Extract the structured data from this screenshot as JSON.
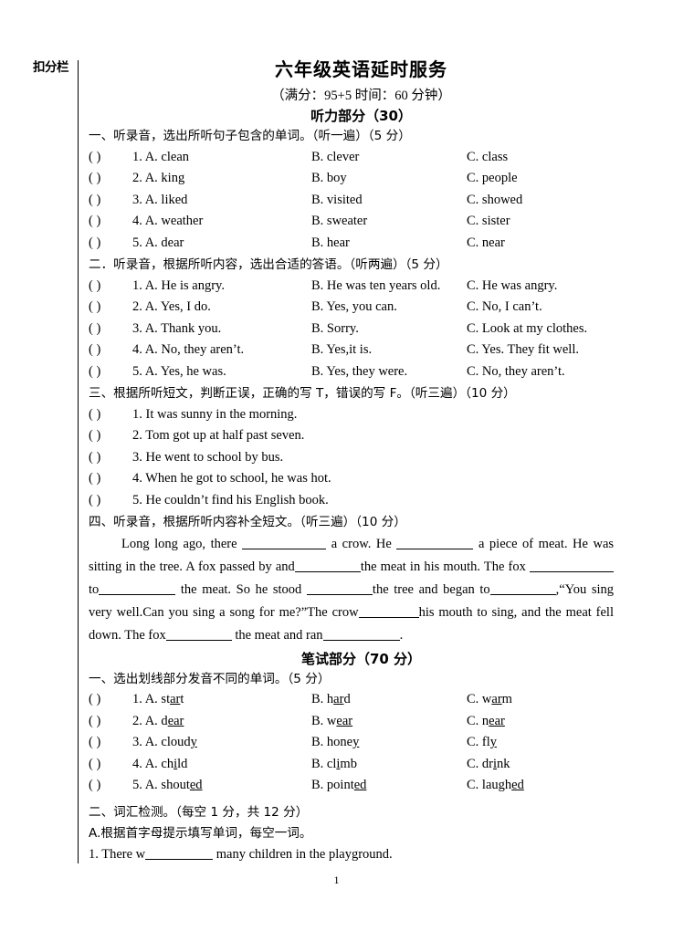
{
  "deduction_column": {
    "label": "扣分栏"
  },
  "header": {
    "title": "六年级英语延时服务",
    "subtitle": "（满分：95+5    时间：60 分钟）"
  },
  "parts": [
    {
      "heading": "听力部分（30）",
      "sections": [
        {
          "heading": "一、听录音，选出所听句子包含的单词。（听一遍）（5 分）",
          "type": "mcq",
          "items": [
            {
              "paren": "(        )",
              "num": "1.",
              "a": "A. clean",
              "b": "B. clever",
              "c": "C. class"
            },
            {
              "paren": "(        )",
              "num": "2.",
              "a": "A. king",
              "b": "B. boy",
              "c": "C. people"
            },
            {
              "paren": "(        )",
              "num": "3.",
              "a": "A. liked",
              "b": "B. visited",
              "c": "C. showed"
            },
            {
              "paren": "(        )",
              "num": "4.",
              "a": "A. weather",
              "b": "B. sweater",
              "c": "C. sister"
            },
            {
              "paren": "(        )",
              "num": "5.",
              "a": "A. dear",
              "b": "B. hear",
              "c": "C. near"
            }
          ]
        },
        {
          "heading": "二．听录音，根据所听内容，选出合适的答语。（听两遍）（5 分）",
          "type": "mcq",
          "items": [
            {
              "paren": "(        )",
              "num": "1.",
              "a": "A. He is angry.",
              "b": "B. He was ten years old.",
              "c": "C. He was angry."
            },
            {
              "paren": "(        )",
              "num": "2.",
              "a": "A. Yes, I do.",
              "b": "B. Yes, you can.",
              "c": "C. No, I can’t."
            },
            {
              "paren": "(        )",
              "num": "3.",
              "a": "A. Thank you.",
              "b": "B. Sorry.",
              "c": "C. Look at my clothes."
            },
            {
              "paren": "(        )",
              "num": "4.",
              "a": "A. No, they aren’t.",
              "b": "B. Yes,it is.",
              "c": "C. Yes. They fit well."
            },
            {
              "paren": "(        )",
              "num": "5.",
              "a": "A. Yes, he was.",
              "b": "B. Yes, they were.",
              "c": "C. No, they aren’t."
            }
          ]
        },
        {
          "heading": "三、根据所听短文，判断正误，正确的写 T，错误的写 F。（听三遍）（10 分）",
          "type": "truefalse",
          "items": [
            {
              "paren": "(        )",
              "num": "1.",
              "text": "It was sunny in the morning."
            },
            {
              "paren": "(        )",
              "num": "2.",
              "text": "Tom got up at half past seven."
            },
            {
              "paren": "(        )",
              "num": "3.",
              "text": "He went to school by bus."
            },
            {
              "paren": "(        )",
              "num": "4.",
              "text": "When he got to school, he was hot."
            },
            {
              "paren": "(        )",
              "num": "5.",
              "text": "He couldn’t find his English book."
            }
          ]
        },
        {
          "heading": "四、听录音，根据所听内容补全短文。（听三遍）（10 分）",
          "type": "cloze",
          "passage": {
            "t1": "Long long ago, there",
            "t2": "a crow. He",
            "t3": "a piece of meat. He was sitting in the tree. A fox passed by and",
            "t4": "the meat in his mouth. The fox",
            "t5": "to",
            "t6": "the meat. So he stood",
            "t7": "the tree and began to",
            "t8": ",“You sing very well.Can you sing a song for me?”The crow",
            "t9": "his mouth to sing, and the meat fell down. The fox",
            "t10": "the meat and ran",
            "t11": "."
          }
        }
      ]
    },
    {
      "heading": "笔试部分（70 分）",
      "sections": [
        {
          "heading": "一、选出划线部分发音不同的单词。（5 分）",
          "type": "mcq-underline",
          "items": [
            {
              "paren": "(        )",
              "num": "1.",
              "a": [
                "A. st",
                "ar",
                "t"
              ],
              "b": [
                "B. h",
                "ar",
                "d"
              ],
              "c": [
                "C. w",
                "ar",
                "m"
              ]
            },
            {
              "paren": "(        )",
              "num": "2.",
              "a": [
                "A. d",
                "ear",
                ""
              ],
              "b": [
                "B. w",
                "ear",
                ""
              ],
              "c": [
                "C. n",
                "ear",
                ""
              ]
            },
            {
              "paren": "(        )",
              "num": "3.",
              "a": [
                "A. cloud",
                "y",
                ""
              ],
              "b": [
                "B. hone",
                "y",
                ""
              ],
              "c": [
                "C. fl",
                "y",
                ""
              ]
            },
            {
              "paren": "(        )",
              "num": "4.",
              "a": [
                "A. ch",
                "i",
                "ld"
              ],
              "b": [
                "B. cl",
                "i",
                "mb"
              ],
              "c": [
                "C. dr",
                "i",
                "nk"
              ]
            },
            {
              "paren": "(        )",
              "num": "5.",
              "a": [
                "A. shout",
                "ed",
                ""
              ],
              "b": [
                "B. point",
                "ed",
                ""
              ],
              "c": [
                "C. laugh",
                "ed",
                ""
              ]
            }
          ]
        },
        {
          "heading": "二、词汇检测。（每空 1 分，共 12 分）",
          "type": "fill",
          "subheading": "A.根据首字母提示填写单词，每空一词。",
          "items": [
            {
              "pre": "1. There w",
              "post": " many children in the playground."
            }
          ]
        }
      ]
    }
  ],
  "footer": {
    "page_number": "1"
  }
}
